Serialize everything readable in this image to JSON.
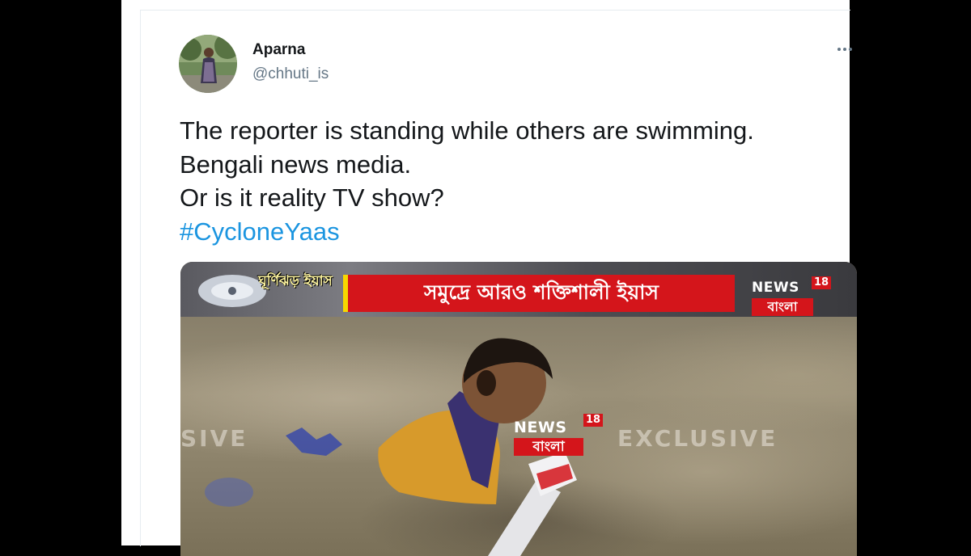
{
  "tweet": {
    "author": {
      "display_name": "Aparna",
      "handle": "@chhuti_is",
      "avatar_icon": "user-avatar-photo"
    },
    "more_icon": "ellipsis-icon",
    "text_lines": [
      "The reporter is standing while others are swimming.",
      "Bengali news media.",
      "Or is it reality TV show?"
    ],
    "hashtag": "#CycloneYaas",
    "colors": {
      "hashtag": "#1b95e0",
      "text": "#14171a",
      "secondary": "#657786"
    }
  },
  "media": {
    "storm_label": "ঘূর্ণিঝড় ইয়াস",
    "headline": "সমুদ্রে আরও শক্তিশালী ইয়াস",
    "channel_logo": {
      "name": "NEWS",
      "number": "18",
      "language": "বাংলা"
    },
    "watermark_left": "SIVE",
    "watermark_right": "EXCLUSIVE",
    "mic_logo": {
      "name": "NEWS",
      "number": "18",
      "language": "বাংলা"
    },
    "colors": {
      "headline_bg": "#d4151b",
      "accent": "#f7d700"
    }
  }
}
